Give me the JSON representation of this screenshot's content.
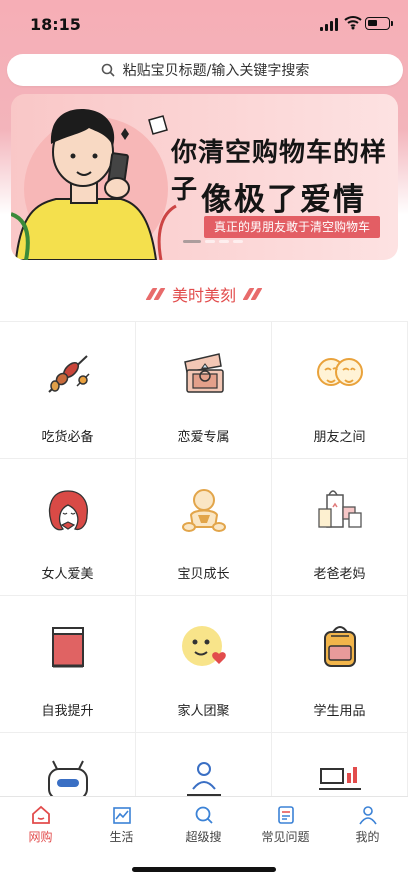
{
  "status_bar": {
    "time": "18:15"
  },
  "search": {
    "placeholder": "粘贴宝贝标题/输入关键字搜索"
  },
  "banner": {
    "headline_1": "你清空购物车的样子",
    "headline_2": "像极了爱情",
    "tagline": "真正的男朋友敢于清空购物车"
  },
  "section": {
    "title": "美时美刻"
  },
  "categories": [
    {
      "label": "吃货必备",
      "icon": "skewer-icon"
    },
    {
      "label": "恋爱专属",
      "icon": "ring-box-icon"
    },
    {
      "label": "朋友之间",
      "icon": "friends-faces-icon"
    },
    {
      "label": "女人爱美",
      "icon": "woman-hair-icon"
    },
    {
      "label": "宝贝成长",
      "icon": "baby-icon"
    },
    {
      "label": "老爸老妈",
      "icon": "gift-bags-icon"
    },
    {
      "label": "自我提升",
      "icon": "book-icon"
    },
    {
      "label": "家人团聚",
      "icon": "smiley-heart-icon"
    },
    {
      "label": "学生用品",
      "icon": "backpack-icon"
    },
    {
      "label": "",
      "icon": "robot-icon"
    },
    {
      "label": "",
      "icon": "meditation-icon"
    },
    {
      "label": "",
      "icon": "desk-chart-icon"
    }
  ],
  "tabs": [
    {
      "label": "网购",
      "icon": "home-icon",
      "active": true
    },
    {
      "label": "生活",
      "icon": "chart-icon",
      "active": false
    },
    {
      "label": "超级搜",
      "icon": "search-icon",
      "active": false
    },
    {
      "label": "常见问题",
      "icon": "document-icon",
      "active": false
    },
    {
      "label": "我的",
      "icon": "user-icon",
      "active": false
    }
  ],
  "colors": {
    "accent": "#e24c4c",
    "banner_pink": "#f6aeb6",
    "tab_blue": "#3b82d6"
  }
}
